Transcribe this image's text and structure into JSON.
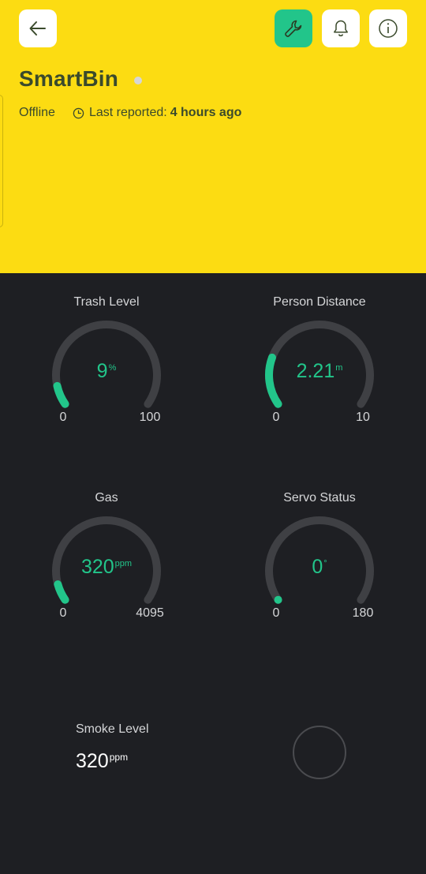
{
  "header": {
    "title": "SmartBin",
    "status": "Offline",
    "last_reported_label": "Last reported:",
    "last_reported_value": "4 hours ago",
    "colors": {
      "background": "#FCDC12",
      "accent": "#22C58A",
      "text": "#3A4A2C"
    },
    "icons": [
      "back-arrow-icon",
      "wrench-icon",
      "bell-icon",
      "info-icon",
      "clock-icon"
    ]
  },
  "gauges": [
    {
      "label": "Trash Level",
      "value": "9",
      "unit": "%",
      "min": "0",
      "max": "100",
      "fraction": 0.09
    },
    {
      "label": "Person Distance",
      "value": "2.21",
      "unit": "m",
      "min": "0",
      "max": "10",
      "fraction": 0.221
    },
    {
      "label": "Gas",
      "value": "320",
      "unit": "ppm",
      "min": "0",
      "max": "4095",
      "fraction": 0.078
    },
    {
      "label": "Servo Status",
      "value": "0",
      "unit": "°",
      "min": "0",
      "max": "180",
      "fraction": 0.0
    }
  ],
  "smoke": {
    "label": "Smoke Level",
    "value": "320",
    "unit": "ppm"
  },
  "colors": {
    "dashboard_bg": "#1E1F23",
    "gauge_track": "#3F4044",
    "gauge_fill": "#22C58A"
  }
}
